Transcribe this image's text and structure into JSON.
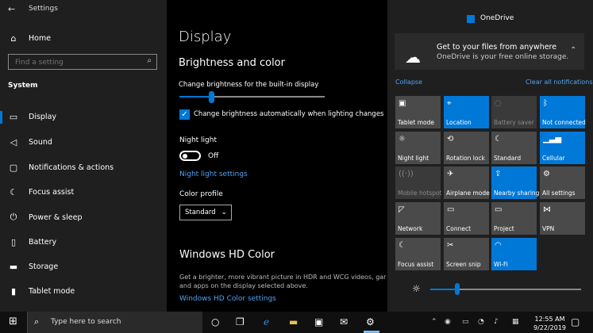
{
  "window": {
    "title": "Settings",
    "back_glyph": "←"
  },
  "sidebar": {
    "home": "Home",
    "search_placeholder": "Find a setting",
    "section": "System",
    "items": [
      {
        "label": "Display",
        "icon": "monitor-icon"
      },
      {
        "label": "Sound",
        "icon": "speaker-icon"
      },
      {
        "label": "Notifications & actions",
        "icon": "notifications-icon"
      },
      {
        "label": "Focus assist",
        "icon": "moon-icon"
      },
      {
        "label": "Power & sleep",
        "icon": "power-icon"
      },
      {
        "label": "Battery",
        "icon": "battery-icon"
      },
      {
        "label": "Storage",
        "icon": "storage-icon"
      },
      {
        "label": "Tablet mode",
        "icon": "tablet-icon"
      }
    ]
  },
  "main": {
    "title": "Display",
    "brightness_heading": "Brightness and color",
    "brightness_label": "Change brightness for the built-in display",
    "brightness_value": 22,
    "auto_brightness_label": "Change brightness automatically when lighting changes",
    "auto_brightness_checked": true,
    "night_light_heading": "Night light",
    "night_light_state": "Off",
    "night_light_link": "Night light settings",
    "color_profile_heading": "Color profile",
    "color_profile_value": "Standard",
    "hd_heading": "Windows HD Color",
    "hd_desc": "Get a brighter, more vibrant picture in HDR and WCG videos, gar and apps on the display selected above.",
    "hd_link": "Windows HD Color settings"
  },
  "action_center": {
    "app": "OneDrive",
    "notification_title": "Get to your files from anywhere",
    "notification_body": "OneDrive is your free online storage.",
    "collapse": "Collapse",
    "clear_all": "Clear all notifications",
    "tiles": [
      {
        "label": "Tablet mode",
        "state": "off",
        "icon": "tablet-mode-icon"
      },
      {
        "label": "Location",
        "state": "on",
        "icon": "location-icon"
      },
      {
        "label": "Battery saver",
        "state": "disabled",
        "icon": "battery-saver-icon"
      },
      {
        "label": "Not connected",
        "state": "on",
        "icon": "bluetooth-icon"
      },
      {
        "label": "Night light",
        "state": "off",
        "icon": "night-light-icon"
      },
      {
        "label": "Rotation lock",
        "state": "off",
        "icon": "rotation-lock-icon"
      },
      {
        "label": "Standard",
        "state": "off",
        "icon": "focus-standard-icon"
      },
      {
        "label": "Cellular",
        "state": "on",
        "icon": "cellular-icon"
      },
      {
        "label": "Mobile hotspot",
        "state": "disabled",
        "icon": "hotspot-icon"
      },
      {
        "label": "Airplane mode",
        "state": "off",
        "icon": "airplane-icon"
      },
      {
        "label": "Nearby sharing",
        "state": "on",
        "icon": "nearby-sharing-icon"
      },
      {
        "label": "All settings",
        "state": "off",
        "icon": "gear-icon"
      },
      {
        "label": "Network",
        "state": "off",
        "icon": "network-icon"
      },
      {
        "label": "Connect",
        "state": "off",
        "icon": "connect-icon"
      },
      {
        "label": "Project",
        "state": "off",
        "icon": "project-icon"
      },
      {
        "label": "VPN",
        "state": "off",
        "icon": "vpn-icon"
      },
      {
        "label": "Focus assist",
        "state": "off",
        "icon": "focus-assist-icon"
      },
      {
        "label": "Screen snip",
        "state": "off",
        "icon": "screen-snip-icon"
      },
      {
        "label": "Wi-Fi",
        "state": "on",
        "icon": "wifi-icon"
      }
    ],
    "brightness_value": 18
  },
  "taskbar": {
    "search_text": "Type here to search",
    "time": "12:55 AM",
    "date": "9/22/2019"
  },
  "colors": {
    "accent": "#0078d7",
    "link": "#4ea4f3",
    "sidebar_bg": "#1f1f1f",
    "tile_off": "#4a4a4a"
  }
}
